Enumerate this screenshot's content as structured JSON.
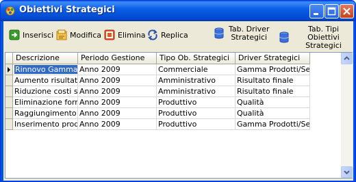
{
  "window": {
    "title": "Obiettivi Strategici"
  },
  "toolbar": {
    "insert_label": "Inserisci",
    "edit_label": "Modifica",
    "delete_label": "Elimina",
    "replicate_label": "Replica",
    "driver_table_line1": "Tab. Driver",
    "driver_table_line2": "Strategici",
    "types_table_line1": "Tab. Tipi Obiettivi",
    "types_table_line2": "Strategici"
  },
  "grid": {
    "columns": [
      "Descrizione",
      "Periodo Gestione",
      "Tipo Ob. Strategici",
      "Driver Strategici"
    ],
    "rows": [
      [
        "Rinnovo Gamma Se",
        "Anno 2009",
        "Commerciale",
        "Gamma Prodotti/Servizi"
      ],
      [
        "Aumento risultato op",
        "Anno 2009",
        "Amministrativo",
        "Risultato finale"
      ],
      [
        "Riduzione costi serv",
        "Anno 2009",
        "Amministrativo",
        "Risultato finale"
      ],
      [
        "Eliminazione fornitor",
        "Anno 2009",
        "Produttivo",
        "Qualità"
      ],
      [
        "Raggiungimento Ce",
        "Anno 2009",
        "Produttivo",
        "Qualità"
      ],
      [
        "Inserimento prodotti.",
        "Anno 2009",
        "Produttivo",
        "Gamma Prodotti/Servizi"
      ]
    ]
  },
  "colors": {
    "titlebar": "#0054e3",
    "selection": "#316ac5",
    "client_bg": "#ece9d8"
  }
}
